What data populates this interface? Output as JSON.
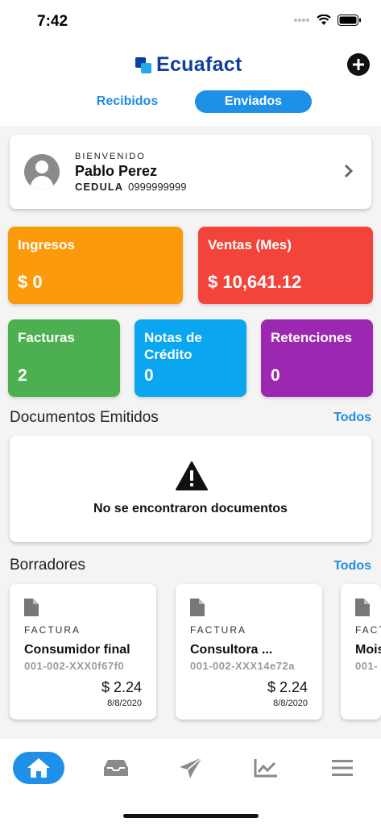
{
  "status_bar": {
    "time": "7:42"
  },
  "header": {
    "brand": "Ecuafact"
  },
  "tabs": [
    {
      "label": "Recibidos"
    },
    {
      "label": "Enviados"
    }
  ],
  "user": {
    "welcome": "BIENVENIDO",
    "name": "Pablo Perez",
    "id_label": "CEDULA",
    "id_value": "0999999999"
  },
  "stats": {
    "ingresos": {
      "label": "Ingresos",
      "value": "$ 0",
      "color": "#fb9a0a"
    },
    "ventas": {
      "label": "Ventas (Mes)",
      "value": "$ 10,641.12",
      "color": "#f2443a"
    },
    "facturas": {
      "label": "Facturas",
      "value": "2",
      "color": "#4caf50"
    },
    "notas": {
      "label": "Notas de Crédito",
      "value": "0",
      "color": "#0aa6f0"
    },
    "retenciones": {
      "label": "Retenciones",
      "value": "0",
      "color": "#9c27b0"
    }
  },
  "emitidos": {
    "title": "Documentos Emitidos",
    "link": "Todos",
    "empty_message": "No se encontraron documentos"
  },
  "borradores": {
    "title": "Borradores",
    "link": "Todos",
    "items": [
      {
        "type": "FACTURA",
        "client": "Consumidor final",
        "code": "001-002-XXX0f67f0",
        "amount": "$ 2.24",
        "date": "8/8/2020"
      },
      {
        "type": "FACTURA",
        "client": "Consultora ...",
        "code": "001-002-XXX14e72a",
        "amount": "$ 2.24",
        "date": "8/8/2020"
      },
      {
        "type": "FACT",
        "client": "Mois",
        "code": "001-"
      }
    ]
  },
  "nav": [
    {
      "name": "home-icon",
      "active": true
    },
    {
      "name": "inbox-icon",
      "active": false
    },
    {
      "name": "send-icon",
      "active": false
    },
    {
      "name": "chart-icon",
      "active": false
    },
    {
      "name": "menu-icon",
      "active": false
    }
  ],
  "colors": {
    "primary": "#1e90e8",
    "brand": "#0f3e9c"
  }
}
